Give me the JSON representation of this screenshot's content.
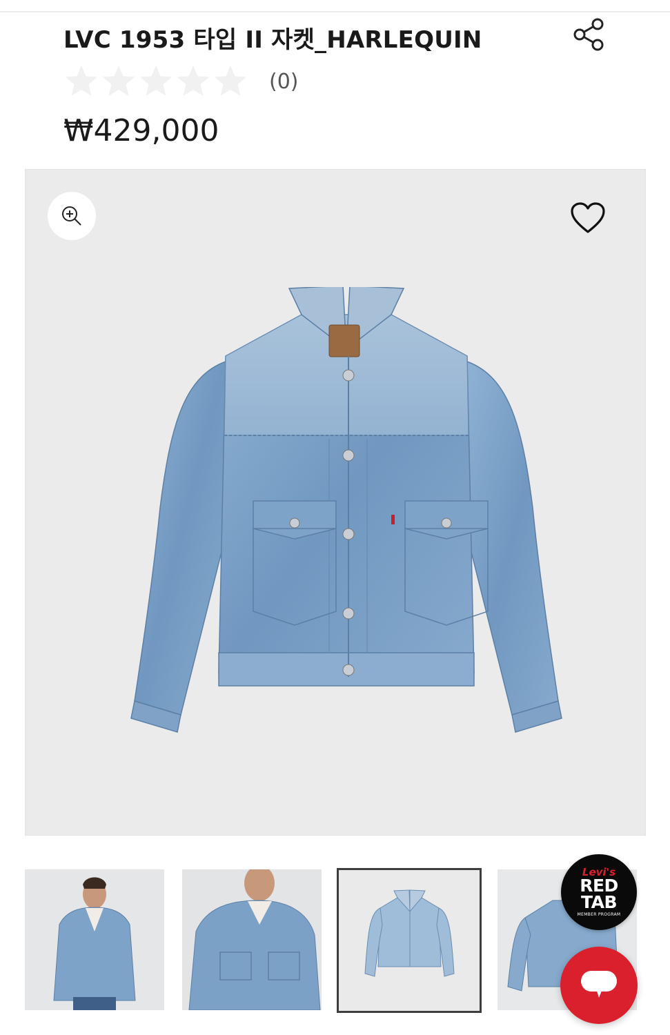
{
  "product": {
    "title": "LVC 1953 타입 II 자켓_HARLEQUIN",
    "rating": 0,
    "max_rating": 5,
    "review_count_label": "(0)",
    "price": "₩429,000"
  },
  "icons": {
    "share": "share-icon",
    "zoom": "zoom-in-icon",
    "wishlist": "heart-icon",
    "chat": "chat-icon"
  },
  "gallery": {
    "selected_index": 2,
    "thumbnails": [
      "model-front",
      "model-closeup",
      "jacket-flat",
      "jacket-back"
    ]
  },
  "badge": {
    "brand": "Levi's",
    "line1": "RED",
    "line2": "TAB",
    "sub": "MEMBER PROGRAM"
  },
  "colors": {
    "accent_red": "#d9202c",
    "star_empty": "#f1f1f1",
    "image_bg": "#ebebeb",
    "denim": "#7da3c8"
  }
}
